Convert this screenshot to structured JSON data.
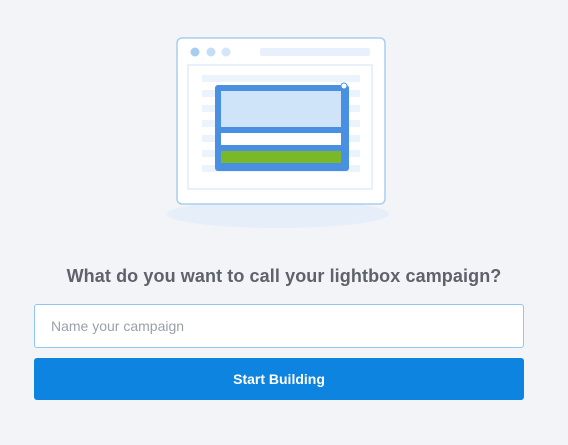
{
  "illustration": {
    "icon": "lightbox-popup-illustration-icon"
  },
  "form": {
    "question": "What do you want to call your lightbox campaign?",
    "name_input": {
      "placeholder": "Name your campaign",
      "value": ""
    },
    "start_button_label": "Start Building"
  },
  "colors": {
    "background": "#f3f4f7",
    "question_text": "#5d626b",
    "input_border": "#8fc6f3",
    "button_background": "#0e84e1",
    "illustration_frame": "#4a90e2",
    "illustration_accent_green": "#7ab828"
  }
}
